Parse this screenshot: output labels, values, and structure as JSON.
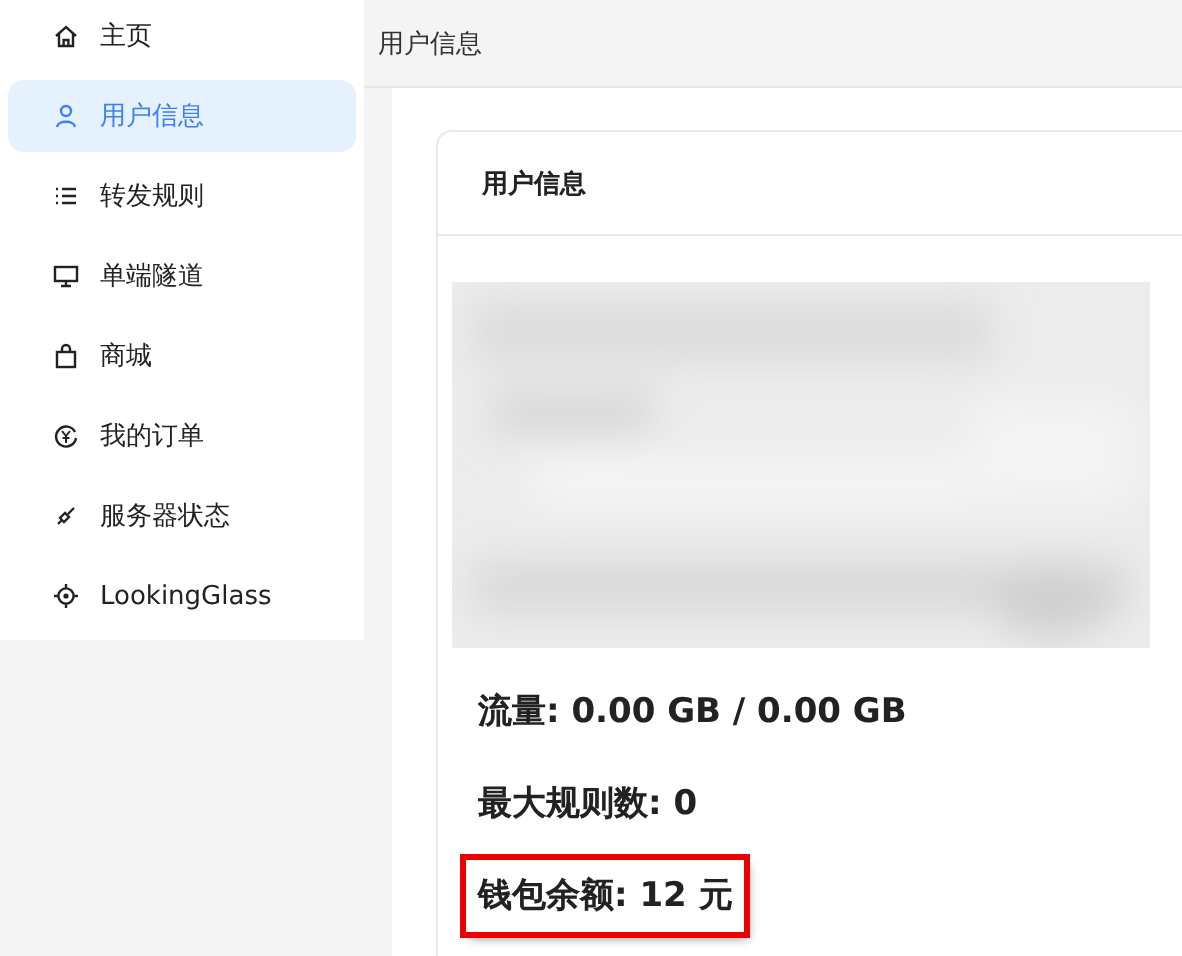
{
  "sidebar": {
    "items": [
      {
        "label": "主页",
        "selected": false
      },
      {
        "label": "用户信息",
        "selected": true
      },
      {
        "label": "转发规则",
        "selected": false
      },
      {
        "label": "单端隧道",
        "selected": false
      },
      {
        "label": "商城",
        "selected": false
      },
      {
        "label": "我的订单",
        "selected": false
      },
      {
        "label": "服务器状态",
        "selected": false
      },
      {
        "label": "LookingGlass",
        "selected": false
      }
    ]
  },
  "breadcrumb": "用户信息",
  "card": {
    "title": "用户信息",
    "stats": [
      {
        "text": "流量: 0.00 GB / 0.00 GB",
        "highlighted": false
      },
      {
        "text": "最大规则数: 0",
        "highlighted": false
      },
      {
        "text": "钱包余额: 12 元",
        "highlighted": true
      }
    ]
  }
}
